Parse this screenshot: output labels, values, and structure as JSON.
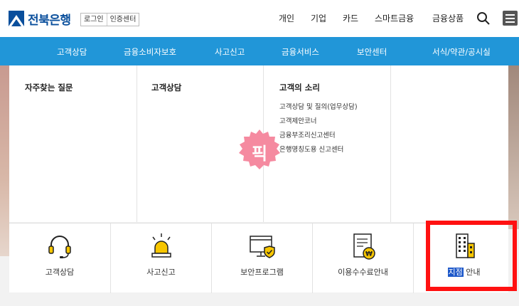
{
  "header": {
    "logo_text": "전북은행",
    "auth": [
      "로그인",
      "인증센터"
    ],
    "top_nav": [
      "개인",
      "기업",
      "카드",
      "스마트금융",
      "금융상품"
    ],
    "search_icon": "search-icon",
    "menu_icon": "hamburger-menu-icon"
  },
  "gnb": [
    "고객상담",
    "금융소비자보호",
    "사고신고",
    "금융서비스",
    "보안센터",
    "서식/약관/공시실"
  ],
  "panel": {
    "columns": [
      "자주찾는 질문",
      "고객상담",
      "고객의 소리"
    ],
    "sub_links": [
      "고객상담 및 질의(업무상담)",
      "고객제안코너",
      "금융부조리신고센터",
      "은행명칭도용 신고센터"
    ],
    "sticker_text": "픽"
  },
  "quick_menu": [
    {
      "label": "고객상담",
      "icon": "headset-icon"
    },
    {
      "label": "사고신고",
      "icon": "siren-icon"
    },
    {
      "label": "보안프로그램",
      "icon": "monitor-shield-icon"
    },
    {
      "label": "이용수수료안내",
      "icon": "fee-document-icon"
    },
    {
      "label_highlight": "지점",
      "label_rest": " 안내",
      "icon": "building-icon"
    }
  ],
  "colors": {
    "brand_blue": "#0a4f9c",
    "gnb_blue": "#2196d8",
    "accent_yellow": "#f7c600",
    "highlight_red": "#ff1111",
    "sticker_pink": "#f58aa0"
  }
}
